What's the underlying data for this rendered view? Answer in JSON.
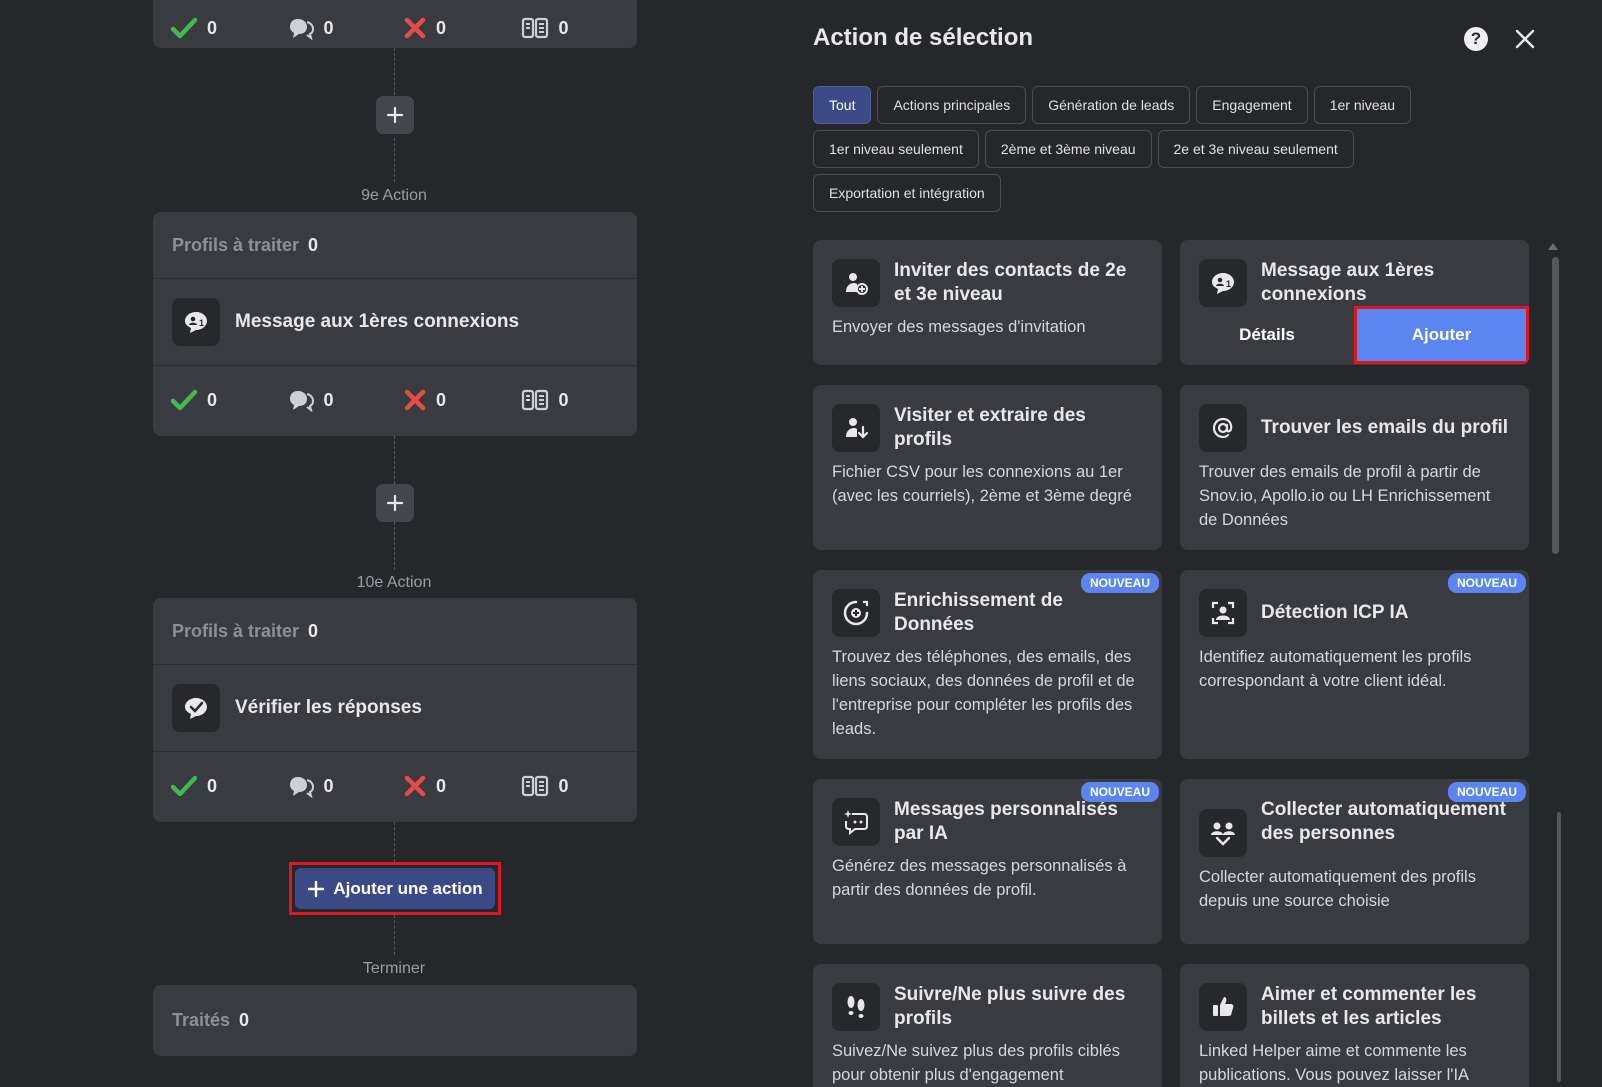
{
  "workflow": {
    "top_stats": [
      "0",
      "0",
      "0",
      "0"
    ],
    "step9_label": "9e Action",
    "step9": {
      "profiles_label": "Profils à traiter",
      "profiles_count": "0",
      "action_title": "Message aux 1ères connexions",
      "stats": [
        "0",
        "0",
        "0",
        "0"
      ]
    },
    "step10_label": "10e Action",
    "step10": {
      "profiles_label": "Profils à traiter",
      "profiles_count": "0",
      "action_title": "Vérifier les réponses",
      "stats": [
        "0",
        "0",
        "0",
        "0"
      ]
    },
    "add_action_label": "Ajouter une action",
    "finish_label": "Terminer",
    "processed_label": "Traités",
    "processed_count": "0"
  },
  "panel": {
    "title": "Action de sélection",
    "help_glyph": "?",
    "filters": [
      "Tout",
      "Actions principales",
      "Génération de leads",
      "Engagement",
      "1er niveau",
      "1er niveau seulement",
      "2ème et 3ème niveau",
      "2e et 3e niveau seulement",
      "Exportation et intégration"
    ],
    "active_filter": "Tout",
    "cards": [
      {
        "title": "Inviter des contacts de 2e et 3e niveau",
        "desc": "Envoyer des messages d'invitation",
        "icon": "invite-user-icon"
      },
      {
        "title": "Message aux 1ères connexions",
        "details_label": "Détails",
        "add_label": "Ajouter",
        "icon": "message-first-icon"
      },
      {
        "title": "Visiter et extraire des profils",
        "desc": "Fichier CSV pour les connexions au 1er (avec les courriels), 2ème et 3ème degré",
        "icon": "visit-extract-icon"
      },
      {
        "title": "Trouver les emails du profil",
        "desc": "Trouver des emails de profil à partir de Snov.io, Apollo.io ou LH Enrichissement de Données",
        "icon": "at-icon"
      },
      {
        "title": "Enrichissement de Données",
        "desc": "Trouvez des téléphones, des emails, des liens sociaux, des données de profil et de l'entreprise pour compléter les profils des leads.",
        "badge": "NOUVEAU",
        "icon": "enrich-icon"
      },
      {
        "title": "Détection ICP IA",
        "desc": "Identifiez automatiquement les profils correspondant à votre client idéal.",
        "badge": "NOUVEAU",
        "icon": "icp-detect-icon"
      },
      {
        "title": "Messages personnalisés par IA",
        "desc": "Générez des messages personnalisés à partir des données de profil.",
        "badge": "NOUVEAU",
        "icon": "ai-message-icon"
      },
      {
        "title": "Collecter automatiquement des personnes",
        "desc": "Collecter automatiquement des profils depuis une source choisie",
        "badge": "NOUVEAU",
        "icon": "collect-people-icon"
      },
      {
        "title": "Suivre/Ne plus suivre des profils",
        "desc": "Suivez/Ne suivez plus des profils ciblés pour obtenir plus d'engagement",
        "icon": "footsteps-icon"
      },
      {
        "title": "Aimer et commenter les billets et les articles",
        "desc": "Linked Helper aime et commente les publications. Vous pouvez laisser l'IA",
        "icon": "thumbs-up-icon"
      }
    ]
  },
  "colors": {
    "background": "#26272b",
    "card": "#3a3b41",
    "accent": "#3b4a86",
    "add_button": "#5b86f2",
    "highlight": "#e0151f",
    "success": "#3fb950",
    "danger": "#e5484d"
  }
}
